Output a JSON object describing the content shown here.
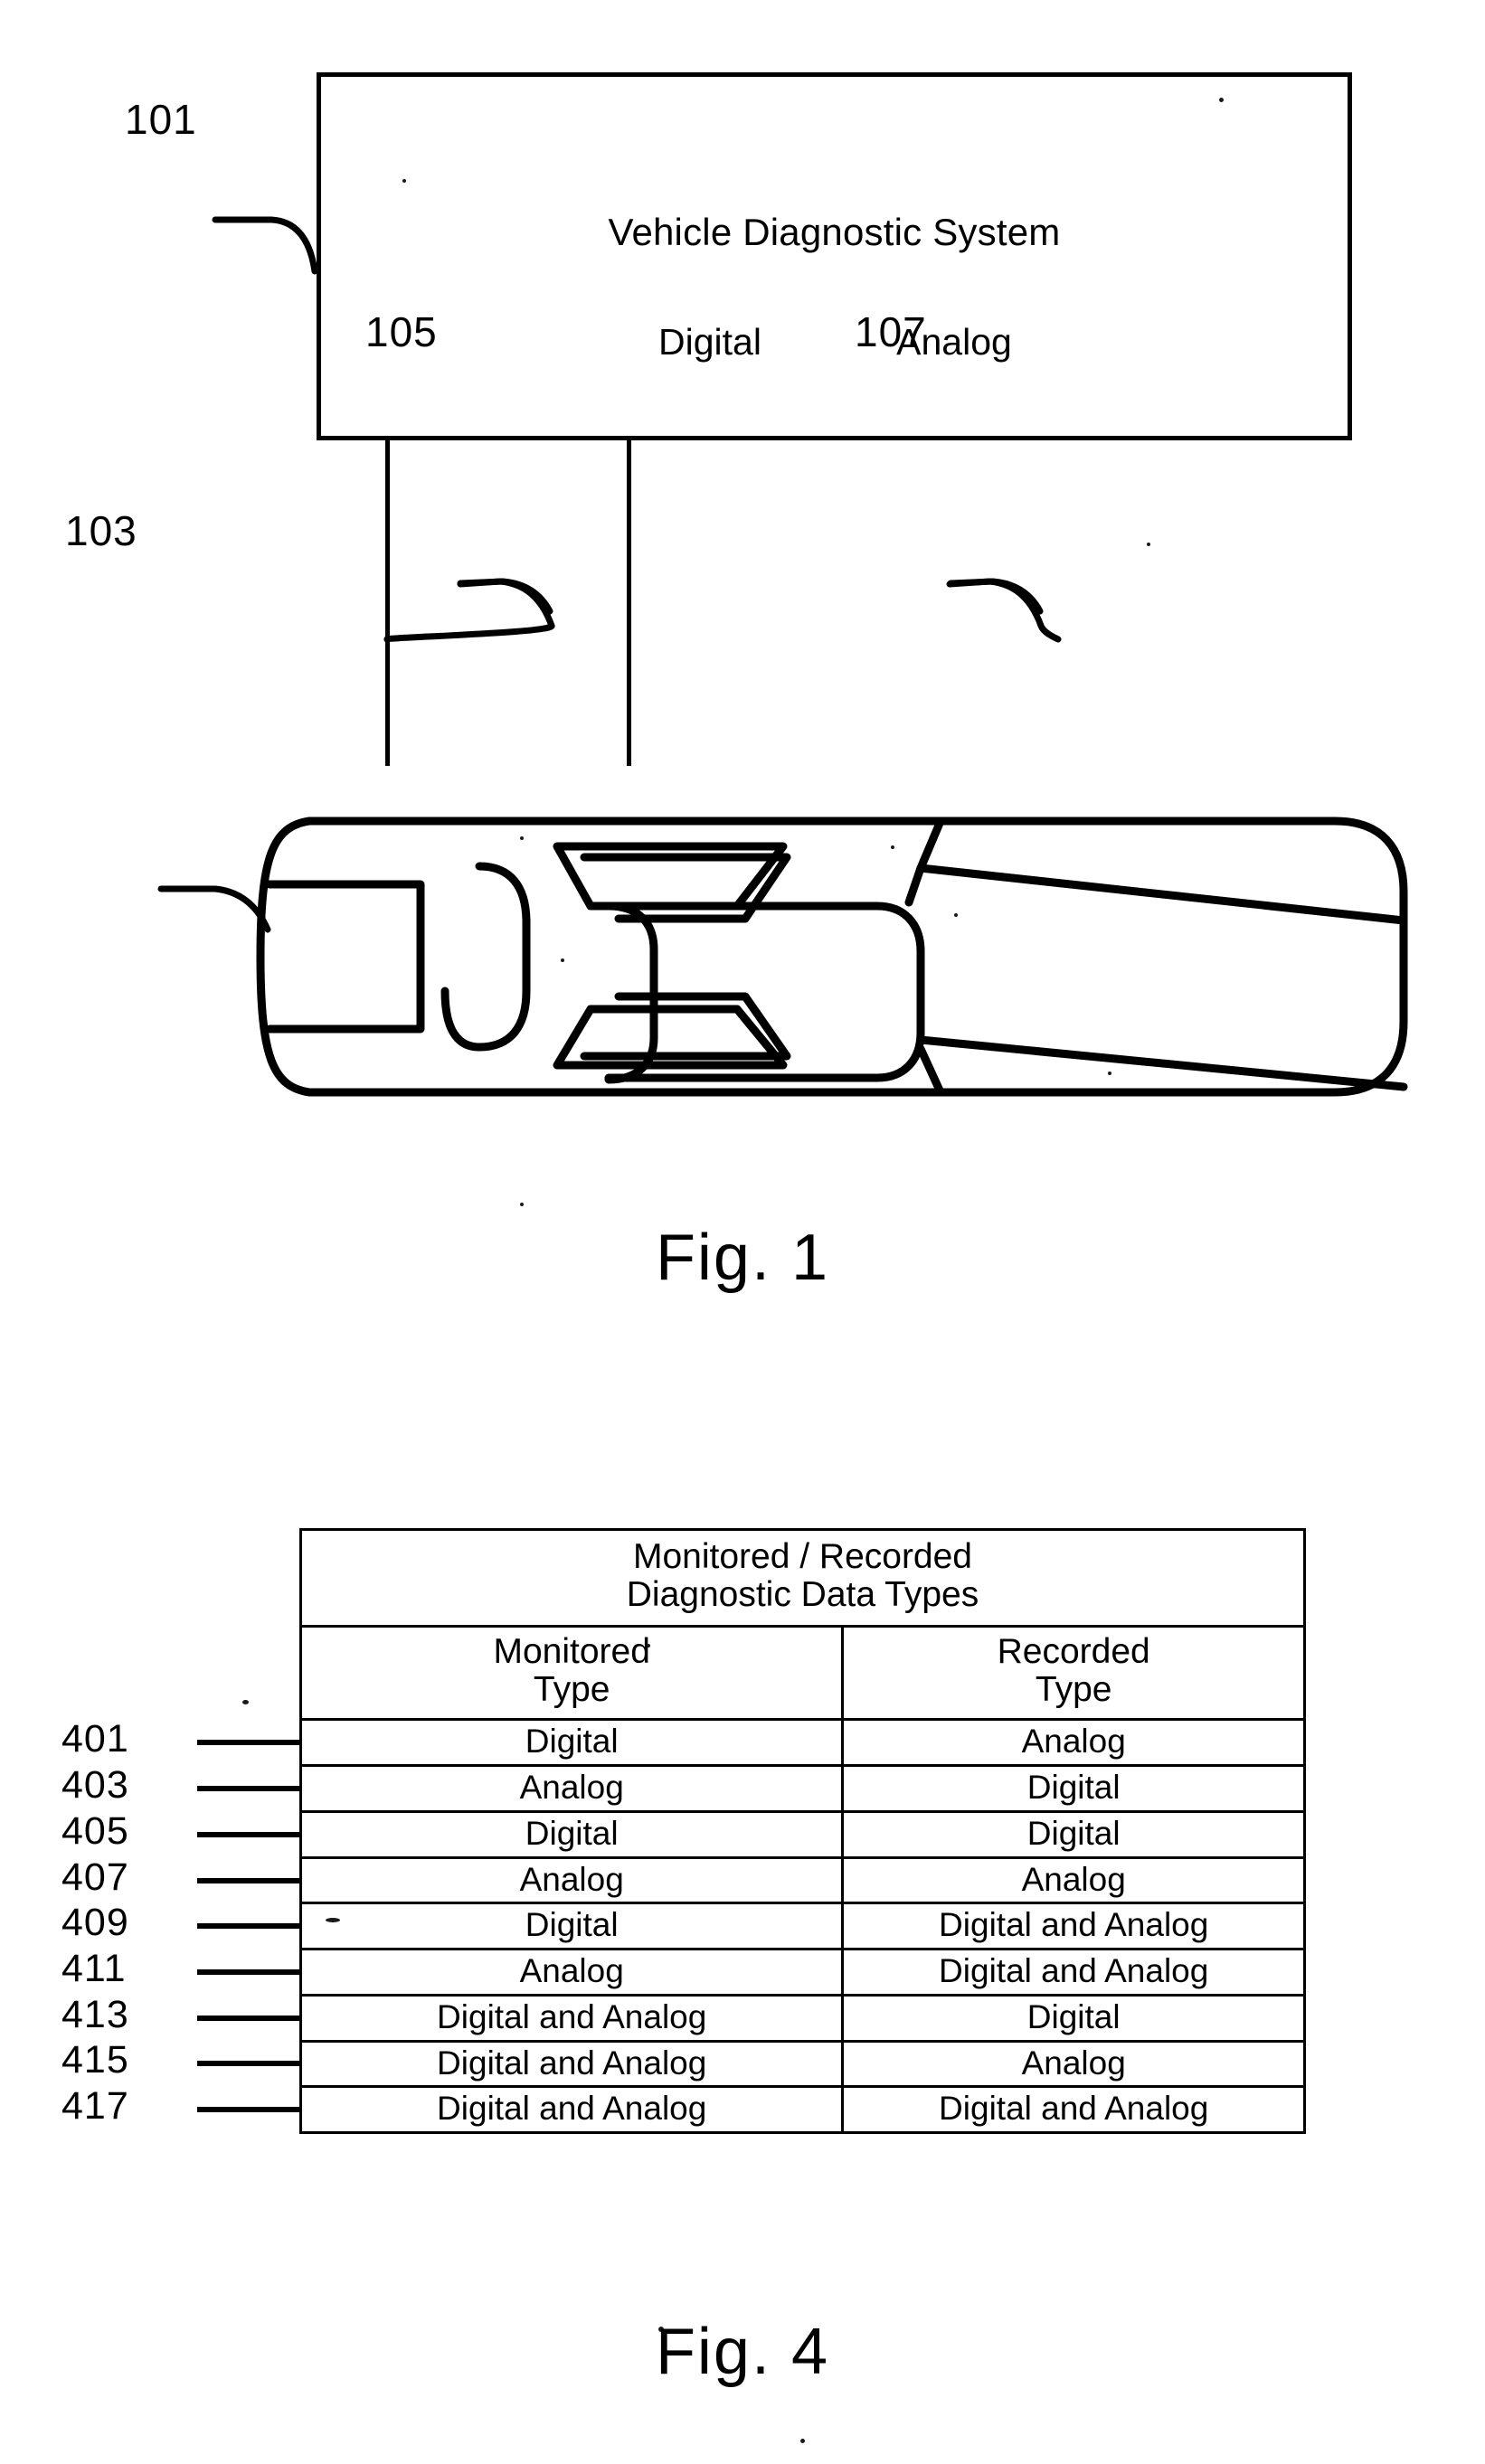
{
  "figure1": {
    "caption": "Fig. 1",
    "system_box": {
      "title": "Vehicle Diagnostic System",
      "ports": [
        {
          "label": "Digital"
        },
        {
          "label": "Analog"
        }
      ],
      "ref": "101"
    },
    "vehicle": {
      "ref": "103"
    },
    "connections": [
      {
        "ref": "105",
        "from": "Digital",
        "to": "vehicle"
      },
      {
        "ref": "107",
        "from": "Analog",
        "to": "vehicle"
      }
    ]
  },
  "figure4": {
    "caption": "Fig. 4",
    "table": {
      "title_line1": "Monitored / Recorded",
      "title_line2": "Diagnostic Data Types",
      "columns": [
        {
          "head_line1": "Monitored",
          "head_line2": "Type"
        },
        {
          "head_line1": "Recorded",
          "head_line2": "Type"
        }
      ],
      "rows": [
        {
          "ref": "401",
          "monitored": "Digital",
          "recorded": "Analog"
        },
        {
          "ref": "403",
          "monitored": "Analog",
          "recorded": "Digital"
        },
        {
          "ref": "405",
          "monitored": "Digital",
          "recorded": "Digital"
        },
        {
          "ref": "407",
          "monitored": "Analog",
          "recorded": "Analog"
        },
        {
          "ref": "409",
          "monitored": "Digital",
          "recorded": "Digital and Analog"
        },
        {
          "ref": "411",
          "monitored": "Analog",
          "recorded": "Digital and Analog"
        },
        {
          "ref": "413",
          "monitored": "Digital and Analog",
          "recorded": "Digital"
        },
        {
          "ref": "415",
          "monitored": "Digital and Analog",
          "recorded": "Analog"
        },
        {
          "ref": "417",
          "monitored": "Digital and Analog",
          "recorded": "Digital and Analog"
        }
      ]
    }
  },
  "style": {
    "ink": "#000000",
    "paper": "#ffffff"
  }
}
